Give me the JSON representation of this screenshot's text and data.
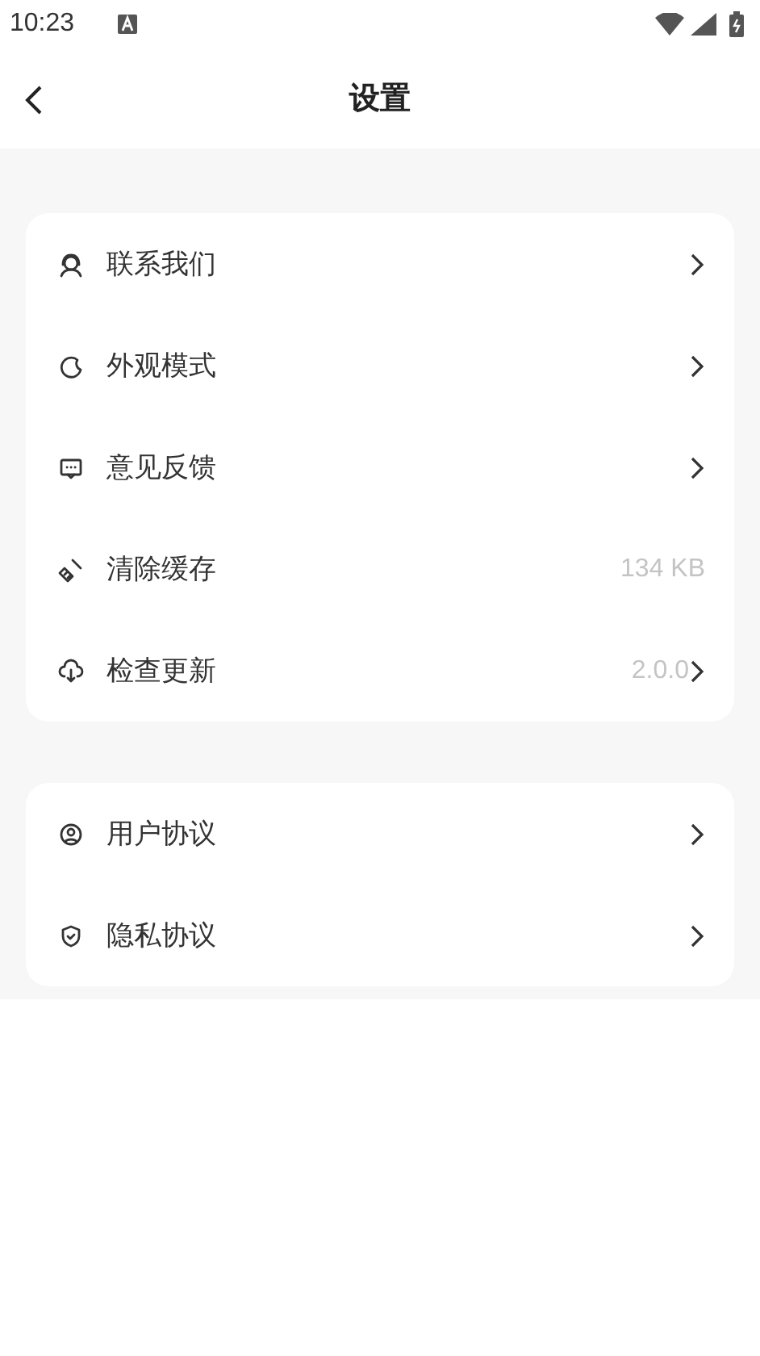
{
  "status_bar": {
    "time": "10:23"
  },
  "header": {
    "title": "设置"
  },
  "groups": [
    {
      "items": [
        {
          "label": "联系我们",
          "chevron": true
        },
        {
          "label": "外观模式",
          "chevron": true
        },
        {
          "label": "意见反馈",
          "chevron": true
        },
        {
          "label": "清除缓存",
          "value": "134 KB",
          "chevron": false
        },
        {
          "label": "检查更新",
          "value": "2.0.0",
          "chevron": true
        }
      ]
    },
    {
      "items": [
        {
          "label": "用户协议",
          "chevron": true
        },
        {
          "label": "隐私协议",
          "chevron": true
        }
      ]
    }
  ]
}
